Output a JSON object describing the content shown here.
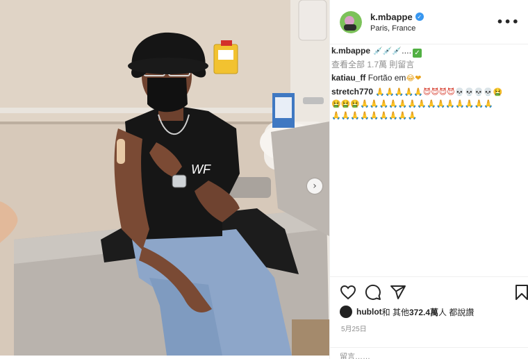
{
  "post": {
    "username": "k.mbappe",
    "location": "Paris, France",
    "more_label": "•••",
    "verified_glyph": "✓"
  },
  "photo": {
    "next_label": "›",
    "shirt_text": "WF"
  },
  "caption": {
    "username": "k.mbappe",
    "emojis": "💉💉💉....",
    "check": "✓"
  },
  "view_all_comments": "查看全部 1.7萬 則留言",
  "comments": [
    {
      "username": "katiau_ff",
      "text": "Fortão em",
      "emojis": "😂❤"
    },
    {
      "username": "stretch770",
      "hands": "🙏🙏🙏🙏🙏",
      "devils": "😈😈😈😈",
      "skulls": "💀💀💀💀",
      "sick1": "🤮",
      "sick2": "🤮🤮🤮",
      "hands2": "🙏🙏🙏🙏🙏🙏🙏🙏🙏🙏🙏🙏🙏🙏",
      "hands3": "🙏🙏🙏🙏🙏🙏🙏🙏🙏"
    }
  ],
  "likes": {
    "prefix_user": "hublot",
    "mid": " 和 其他 ",
    "count": "372.4萬",
    "suffix": " 人 都說讚"
  },
  "date": "5月25日",
  "add_comment_placeholder": "留言……",
  "icons": [
    "heart-icon",
    "comment-icon",
    "share-icon",
    "bookmark-icon"
  ],
  "colors": {
    "verified": "#3897f0",
    "check": "#52b043",
    "heart": "#e0245e"
  }
}
